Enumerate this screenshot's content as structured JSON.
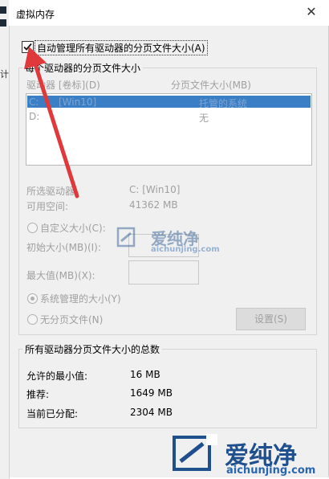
{
  "window": {
    "title": "虚拟内存",
    "close_glyph": "✕"
  },
  "auto_manage": {
    "label": "自动管理所有驱动器的分页文件大小(A)",
    "checked": true
  },
  "drive_group": {
    "title": "每个驱动器的分页文件大小",
    "col_drive": "驱动器 [卷标](D)",
    "col_paging": "分页文件大小(MB)",
    "rows": [
      {
        "drive": "C:",
        "label": "[Win10]",
        "paging": "托管的系统"
      },
      {
        "drive": "D:",
        "label": "",
        "paging": "无"
      }
    ],
    "selected_drive_label": "所选驱动器:",
    "selected_drive_value": "C:  [Win10]",
    "free_space_label": "可用空间:",
    "free_space_value": "41362 MB",
    "custom_size_label": "自定义大小(C):",
    "initial_size_label": "初始大小(MB)(I):",
    "max_size_label": "最大值(MB)(X):",
    "system_managed_label": "系统管理的大小(Y)",
    "no_paging_label": "无分页文件(N)",
    "set_button": "设置(S)"
  },
  "totals_group": {
    "title": "所有驱动器分页文件大小的总数",
    "min_label": "允许的最小值:",
    "min_value": "16 MB",
    "recommended_label": "推荐:",
    "recommended_value": "1649 MB",
    "current_label": "当前已分配:",
    "current_value": "2304 MB"
  },
  "watermark": {
    "brand": "爱纯净",
    "url": "aichunjing.com"
  },
  "colors": {
    "selection": "#3a7fc5",
    "arrow": "#e0393b",
    "watermark": "#1f4f8c"
  }
}
